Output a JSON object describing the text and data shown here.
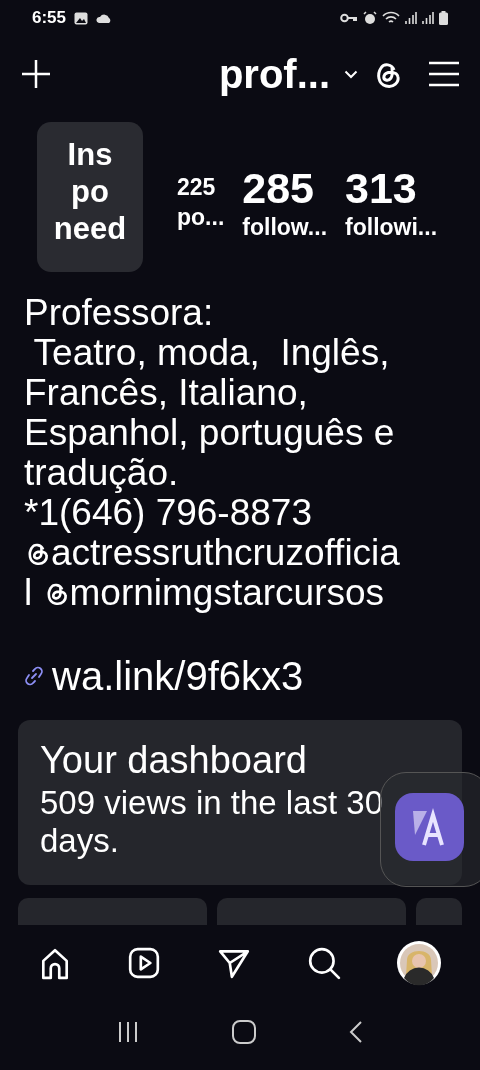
{
  "status_bar": {
    "time": "6:55"
  },
  "header": {
    "username": "prof..."
  },
  "profile": {
    "note": "Ins po need",
    "stats": [
      {
        "value": "225",
        "label": "po...",
        "kind": "small"
      },
      {
        "value": "285",
        "label": "follow...",
        "kind": "large"
      },
      {
        "value": "313",
        "label": "followi...",
        "kind": "large"
      }
    ]
  },
  "bio": [
    [
      {
        "kind": "text",
        "text": "Professora:"
      }
    ],
    [
      {
        "kind": "text",
        "text": " Teatro, moda,  Inglês,"
      }
    ],
    [
      {
        "kind": "text",
        "text": "Francês, Italiano,"
      }
    ],
    [
      {
        "kind": "text",
        "text": "Espanhol, português e"
      }
    ],
    [
      {
        "kind": "text",
        "text": "tradução."
      }
    ],
    [
      {
        "kind": "text",
        "text": "*1(646) 796-8873"
      }
    ],
    [
      {
        "kind": "mention",
        "text": "actressruthcruzofficia"
      }
    ],
    [
      {
        "kind": "text",
        "text": "l "
      },
      {
        "kind": "mention",
        "text": "mornimgstarcursos"
      }
    ]
  ],
  "link": "wa.link/9f6kx3",
  "dashboard": {
    "title": "Your dashboard",
    "subtitle": "509 views in the last 30 days."
  },
  "nav": [
    {
      "kind": "home"
    },
    {
      "kind": "reels"
    },
    {
      "kind": "send"
    },
    {
      "kind": "search"
    },
    {
      "kind": "profile"
    }
  ]
}
